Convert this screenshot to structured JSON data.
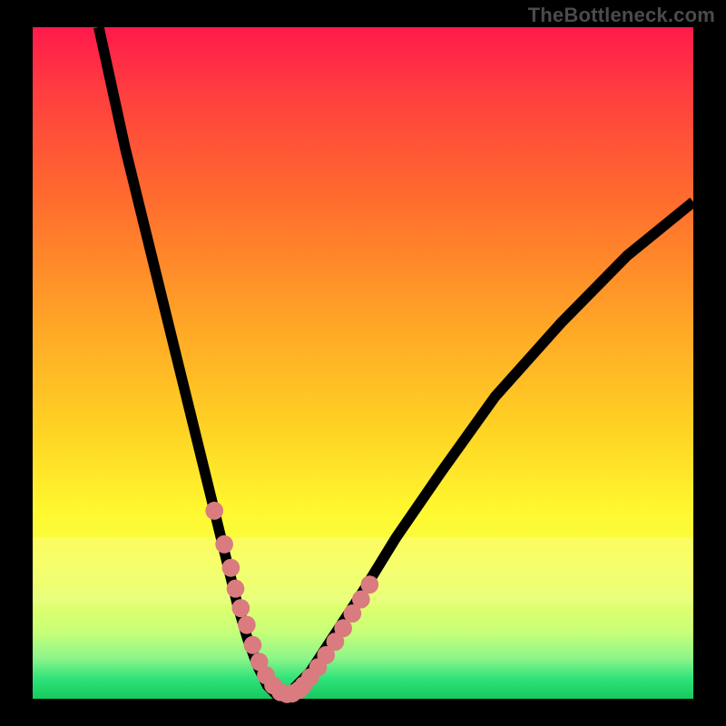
{
  "watermark": "TheBottleneck.com",
  "colors": {
    "gradient_top": "#ff1a4b",
    "gradient_bottom": "#15c95e",
    "curve": "#000000",
    "datapoint": "#d97b7f",
    "frame_bg": "#000000"
  },
  "chart_data": {
    "type": "line",
    "title": "",
    "xlabel": "",
    "ylabel": "",
    "xlim": [
      0,
      100
    ],
    "ylim": [
      0,
      100
    ],
    "annotations": [],
    "note": "Axes carry no labels/ticks; values below are estimated positions in percent of plot area (x: left→right, y: 0=top, 100=bottom).",
    "series": [
      {
        "name": "curve",
        "kind": "line",
        "x": [
          10,
          14,
          18,
          22,
          25,
          27,
          29,
          31,
          32.5,
          34,
          35.5,
          37,
          39,
          42,
          46,
          50,
          55,
          62,
          70,
          80,
          90,
          100
        ],
        "y": [
          0,
          18,
          34,
          50,
          62,
          70,
          78,
          86,
          91,
          95,
          98,
          99.5,
          99,
          96,
          90,
          84,
          76,
          66,
          55,
          44,
          34,
          26
        ]
      },
      {
        "name": "datapoints",
        "kind": "scatter",
        "x": [
          27.5,
          29.0,
          30.0,
          30.7,
          31.5,
          32.4,
          33.3,
          34.3,
          35.3,
          36.4,
          37.5,
          38.5,
          39.3,
          40.3,
          41.0,
          42.0,
          43.2,
          44.4,
          45.8,
          47.0,
          48.4,
          49.7,
          51.0
        ],
        "y": [
          72.0,
          77.0,
          80.5,
          83.6,
          86.5,
          89.0,
          92.0,
          94.5,
          96.5,
          98.0,
          99.0,
          99.3,
          99.2,
          98.7,
          98.0,
          96.8,
          95.3,
          93.5,
          91.5,
          89.5,
          87.3,
          85.2,
          83.0
        ]
      }
    ]
  }
}
